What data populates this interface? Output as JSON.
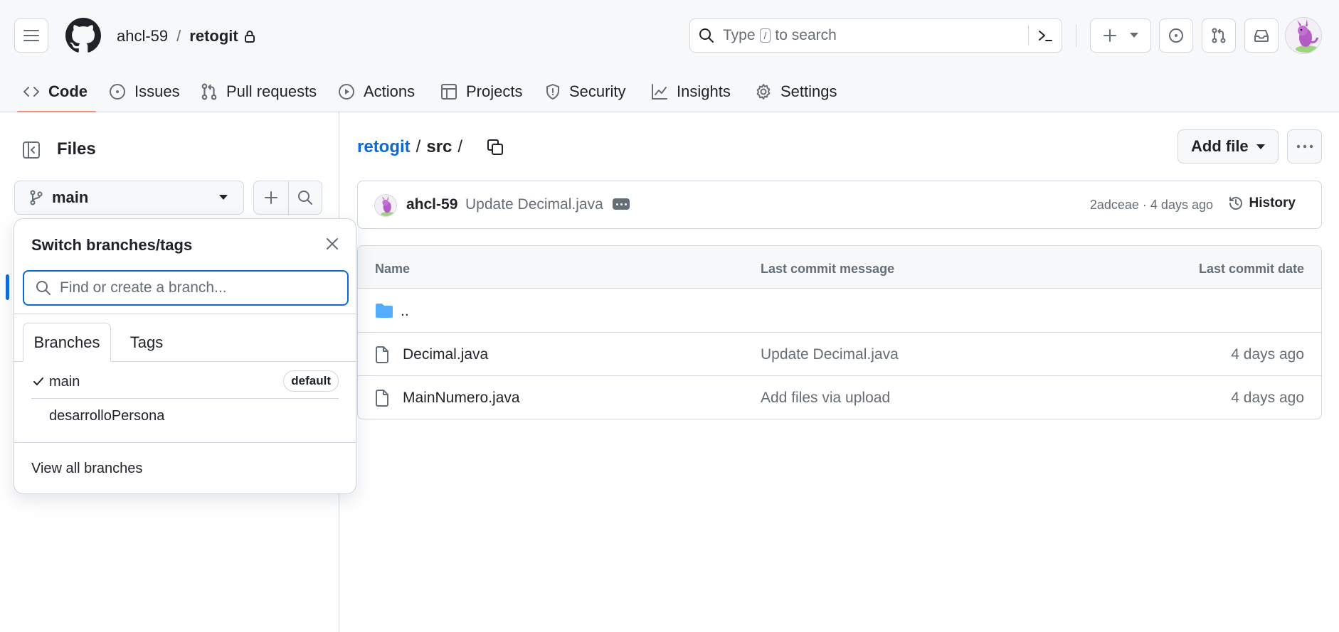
{
  "header": {
    "owner": "ahcl-59",
    "separator": "/",
    "repo": "retogit",
    "search": {
      "prefix": "Type",
      "key": "/",
      "suffix": "to search"
    }
  },
  "nav_tabs": [
    {
      "label": "Code",
      "icon": "code-icon",
      "active": true
    },
    {
      "label": "Issues",
      "icon": "issue-opened-icon"
    },
    {
      "label": "Pull requests",
      "icon": "git-pull-request-icon"
    },
    {
      "label": "Actions",
      "icon": "play-icon"
    },
    {
      "label": "Projects",
      "icon": "table-icon"
    },
    {
      "label": "Security",
      "icon": "shield-icon"
    },
    {
      "label": "Insights",
      "icon": "graph-icon"
    },
    {
      "label": "Settings",
      "icon": "gear-icon"
    }
  ],
  "sidebar": {
    "title": "Files",
    "branch": "main"
  },
  "branch_dropdown": {
    "title": "Switch branches/tags",
    "search_placeholder": "Find or create a branch...",
    "tabs": [
      "Branches",
      "Tags"
    ],
    "branches": [
      {
        "name": "main",
        "selected": true,
        "badge": "default"
      },
      {
        "name": "desarrolloPersona",
        "selected": false
      }
    ],
    "view_all": "View all branches"
  },
  "breadcrumb": {
    "repo": "retogit",
    "folder": "src",
    "sep": "/"
  },
  "actions": {
    "add_file": "Add file"
  },
  "latest_commit": {
    "author": "ahcl-59",
    "message": "Update Decimal.java",
    "meta": "2adceae · 4 days ago",
    "history": "History"
  },
  "file_table": {
    "columns": [
      "Name",
      "Last commit message",
      "Last commit date"
    ],
    "parent": "..",
    "rows": [
      {
        "name": "Decimal.java",
        "commit": "Update Decimal.java",
        "date": "4 days ago"
      },
      {
        "name": "MainNumero.java",
        "commit": "Add files via upload",
        "date": "4 days ago"
      }
    ]
  },
  "colors": {
    "accent_link": "#0969da",
    "tab_underline": "#fd8c73",
    "folder": "#54aeff",
    "border": "#d0d7de",
    "muted": "#656d76"
  }
}
